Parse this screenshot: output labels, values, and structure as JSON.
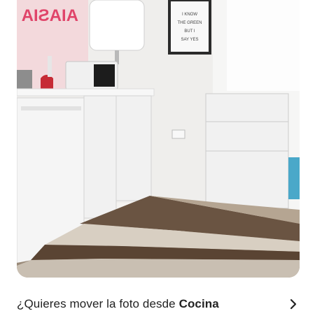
{
  "photo": {
    "alt_wall_sign": "AIASIA",
    "frame_lines": [
      "I KNOW",
      "THE GREEN",
      "BUT I",
      "SAY YES"
    ]
  },
  "move_prompt": {
    "prefix": "¿Quieres mover la foto desde ",
    "room": "Cocina"
  },
  "icons": {
    "chevron": "chevron-right-icon"
  },
  "colors": {
    "text": "#222222",
    "sign": "#e0456a"
  }
}
